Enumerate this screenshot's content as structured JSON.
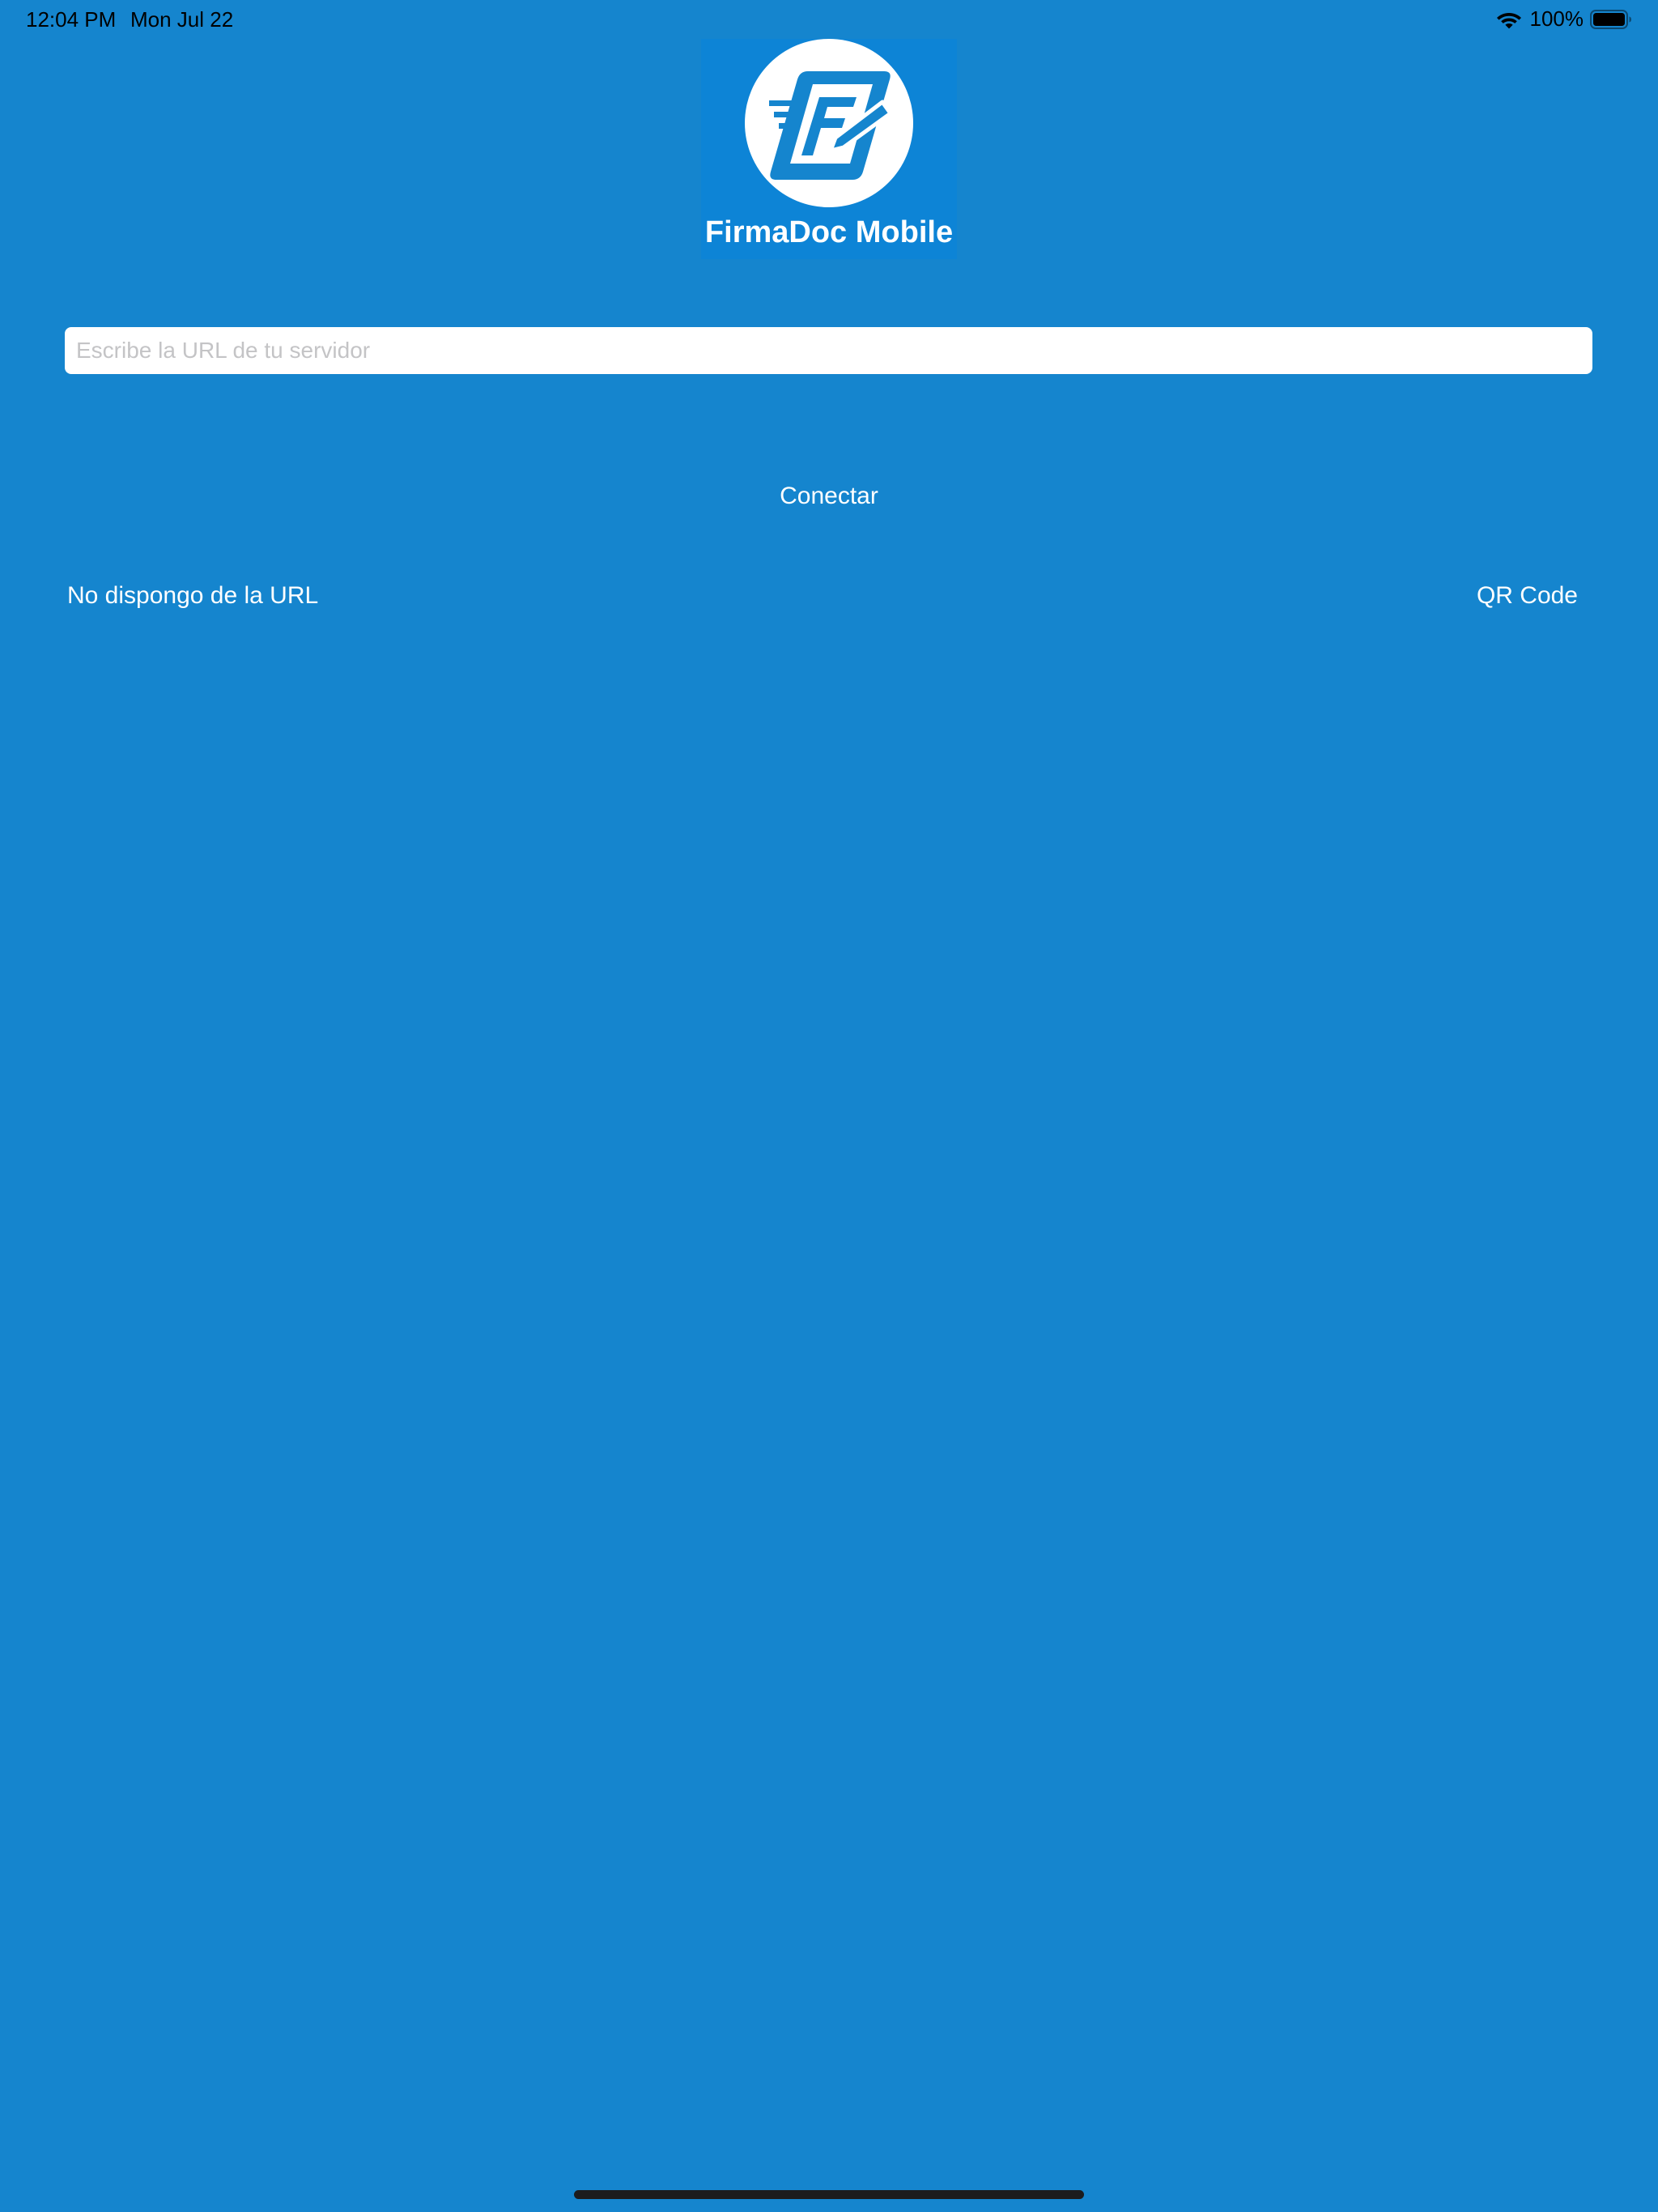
{
  "status_bar": {
    "time": "12:04 PM",
    "date": "Mon Jul 22",
    "battery_percent": "100%",
    "icons": [
      "wifi-icon",
      "battery-icon"
    ]
  },
  "logo": {
    "icon": "firmadoc-logo-icon",
    "title": "FirmaDoc Mobile",
    "brand_color": "#0d84d6"
  },
  "form": {
    "url_placeholder": "Escribe la URL de tu servidor",
    "url_value": "",
    "connect_label": "Conectar",
    "no_url_label": "No dispongo de la URL",
    "qr_label": "QR Code"
  },
  "colors": {
    "background": "#1585ce",
    "text": "#ffffff"
  }
}
